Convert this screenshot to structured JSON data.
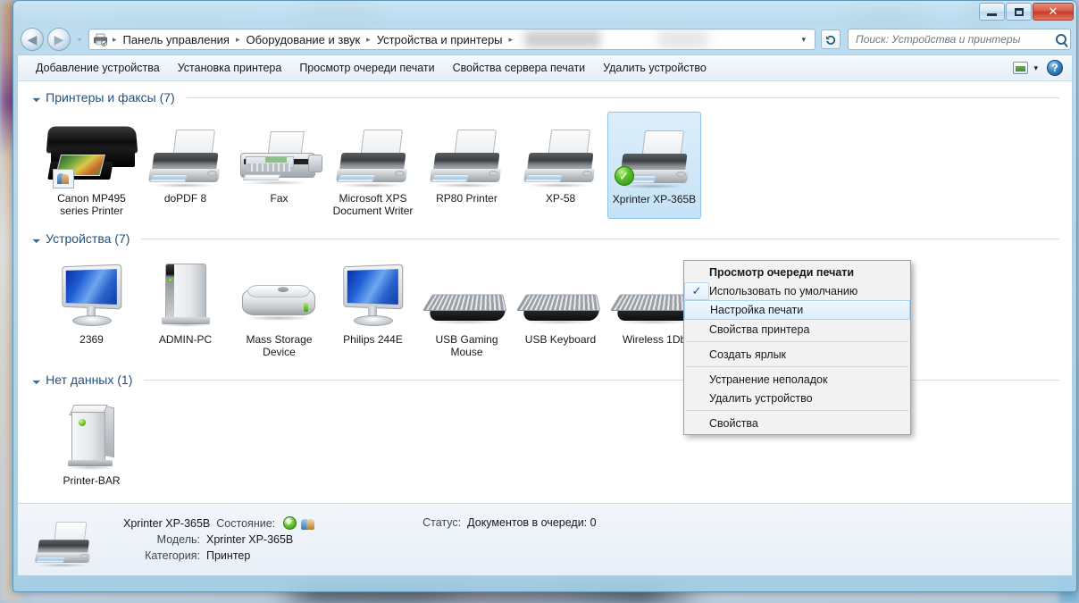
{
  "window": {
    "controls": {
      "minimize": "Свернуть",
      "maximize": "Развернуть",
      "close": "Закрыть",
      "close_glyph": "✕"
    }
  },
  "addressbar": {
    "back_label": "Назад",
    "back_glyph": "◀",
    "forward_label": "Вперёд",
    "forward_glyph": "▶",
    "recent_glyph": "▾",
    "breadcrumb_icon": "printer-icon",
    "crumbs": [
      "Панель управления",
      "Оборудование и звук",
      "Устройства и принтеры"
    ],
    "separator": "▸",
    "dropdown_glyph": "▾",
    "refresh_glyph": "↻",
    "search_placeholder": "Поиск: Устройства и принтеры",
    "search_value": ""
  },
  "toolbar": {
    "items": [
      "Добавление устройства",
      "Установка принтера",
      "Просмотр очереди печати",
      "Свойства сервера печати",
      "Удалить устройство"
    ],
    "view_caret": "▾",
    "help_label": "?"
  },
  "groups": [
    {
      "id": "printers",
      "title": "Принтеры и факсы (7)",
      "collapse_glyph": "◢",
      "items": [
        {
          "label": "Canon MP495 series Printer",
          "icon": "canon-mfp-icon",
          "selected": false,
          "default": false
        },
        {
          "label": "doPDF 8",
          "icon": "printer-icon",
          "selected": false,
          "default": false
        },
        {
          "label": "Fax",
          "icon": "fax-icon",
          "selected": false,
          "default": false
        },
        {
          "label": "Microsoft XPS Document Writer",
          "icon": "printer-icon",
          "selected": false,
          "default": false
        },
        {
          "label": "RP80 Printer",
          "icon": "printer-icon",
          "selected": false,
          "default": false
        },
        {
          "label": "XP-58",
          "icon": "printer-icon",
          "selected": false,
          "default": false
        },
        {
          "label": "Xprinter XP-365B",
          "icon": "printer-icon",
          "selected": true,
          "default": true
        }
      ]
    },
    {
      "id": "devices",
      "title": "Устройства (7)",
      "collapse_glyph": "◢",
      "items": [
        {
          "label": "2369",
          "icon": "monitor-icon"
        },
        {
          "label": "ADMIN-PC",
          "icon": "computer-tower-icon"
        },
        {
          "label": "Mass Storage Device",
          "icon": "hard-drive-icon"
        },
        {
          "label": "Philips 244E",
          "icon": "monitor-icon"
        },
        {
          "label": "USB Gaming Mouse",
          "icon": "keyboard-icon"
        },
        {
          "label": "USB Keyboard",
          "icon": "keyboard-icon"
        },
        {
          "label": "Wireless 1Db",
          "icon": "keyboard-icon"
        }
      ]
    },
    {
      "id": "unspecified",
      "title": "Нет данных (1)",
      "collapse_glyph": "◢",
      "items": [
        {
          "label": "Printer-BAR",
          "icon": "network-device-icon"
        }
      ]
    }
  ],
  "context_menu": {
    "items": [
      {
        "label": "Просмотр очереди печати",
        "bold": true,
        "checked": false,
        "highlighted": false,
        "separator_after": false
      },
      {
        "label": "Использовать по умолчанию",
        "bold": false,
        "checked": true,
        "highlighted": false,
        "separator_after": false
      },
      {
        "label": "Настройка печати",
        "bold": false,
        "checked": false,
        "highlighted": true,
        "separator_after": false
      },
      {
        "label": "Свойства принтера",
        "bold": false,
        "checked": false,
        "highlighted": false,
        "separator_after": true
      },
      {
        "label": "Создать ярлык",
        "bold": false,
        "checked": false,
        "highlighted": false,
        "separator_after": true
      },
      {
        "label": "Устранение неполадок",
        "bold": false,
        "checked": false,
        "highlighted": false,
        "separator_after": false
      },
      {
        "label": "Удалить устройство",
        "bold": false,
        "checked": false,
        "highlighted": false,
        "separator_after": true
      },
      {
        "label": "Свойства",
        "bold": false,
        "checked": false,
        "highlighted": false,
        "separator_after": false
      }
    ],
    "check_glyph": "✓"
  },
  "details": {
    "device_name": "Xprinter XP-365B",
    "state_label": "Состояние:",
    "state_icons": [
      "default-printer-check-icon",
      "shared-users-icon"
    ],
    "model_label": "Модель:",
    "model_value": "Xprinter XP-365B",
    "category_label": "Категория:",
    "category_value": "Принтер",
    "status_label": "Статус:",
    "status_value": "Документов в очереди: 0"
  },
  "colors": {
    "accent_blue": "#24507d",
    "selection_blue": "#c5e2f7",
    "close_red": "#c33a27",
    "green_check": "#2f8c11"
  }
}
